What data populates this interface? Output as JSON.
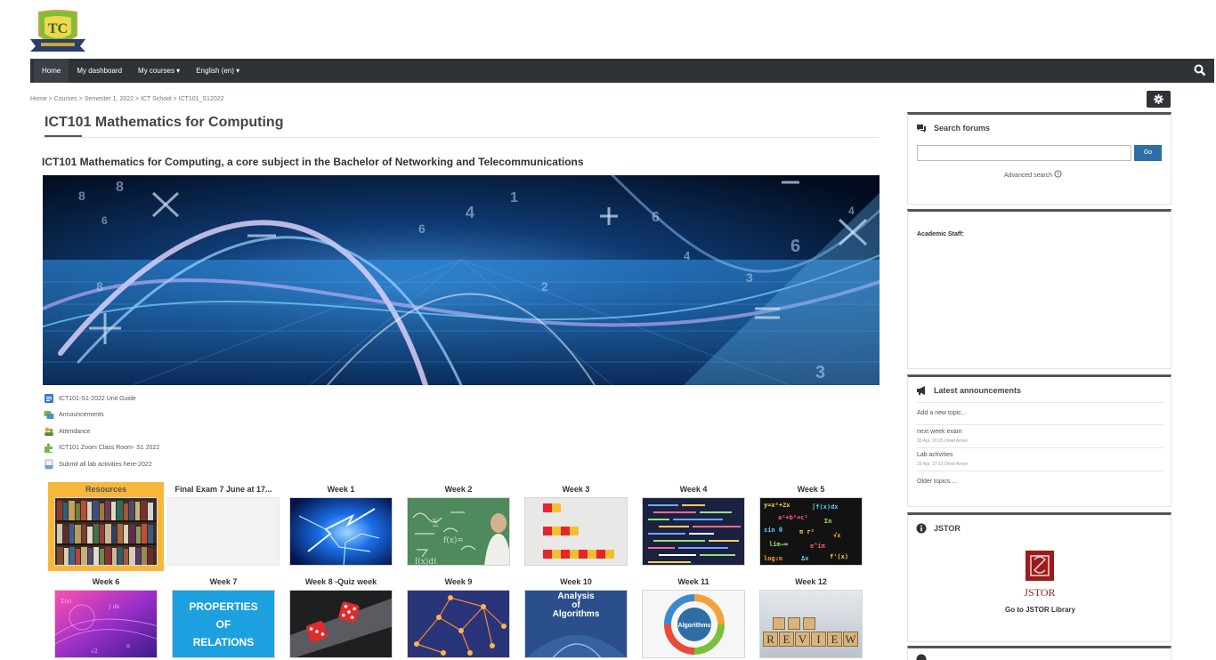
{
  "nav": {
    "items": [
      "Home",
      "My dashboard",
      "My courses ▾",
      "English (en) ▾"
    ]
  },
  "breadcrumb": [
    "Home",
    "Courses",
    "Semester 1, 2022",
    "ICT School",
    "ICT101_S12022"
  ],
  "breadcrumb_sep": ">",
  "page": {
    "title": "ICT101 Mathematics for Computing",
    "description": "ICT101 Mathematics for Computing, a core subject in the Bachelor of Networking and Telecommunications"
  },
  "resources": [
    {
      "label": "ICT101-S1-2022 Unit Guide",
      "icon": "document-icon"
    },
    {
      "label": "Announcements",
      "icon": "forum-icon"
    },
    {
      "label": "Attendance",
      "icon": "attendance-icon"
    },
    {
      "label": "ICT101 Zoom Class Room- S1 2022",
      "icon": "puzzle-icon"
    },
    {
      "label": "Submit all lab activities here-2022",
      "icon": "assignment-icon"
    }
  ],
  "tiles": [
    {
      "title": "Resources",
      "selected": true
    },
    {
      "title": "Final Exam 7 June at 17...",
      "selected": false
    },
    {
      "title": "Week 1",
      "selected": false
    },
    {
      "title": "Week 2",
      "selected": false
    },
    {
      "title": "Week 3",
      "selected": false
    },
    {
      "title": "Week 4",
      "selected": false
    },
    {
      "title": "Week 5",
      "selected": false
    },
    {
      "title": "Week 6",
      "selected": false
    },
    {
      "title": "Week 7",
      "selected": false
    },
    {
      "title": "Week 8 -Quiz week",
      "selected": false
    },
    {
      "title": "Week 9",
      "selected": false
    },
    {
      "title": "Week 10",
      "selected": false
    },
    {
      "title": "Week 11",
      "selected": false
    },
    {
      "title": "Week 12",
      "selected": false
    }
  ],
  "tile_image_text": {
    "week7": [
      "PROPERTIES",
      "OF",
      "RELATIONS"
    ],
    "week10": [
      "Analysis",
      "of",
      "Algorithms"
    ],
    "week11": "Algorithms",
    "week12": [
      "R",
      "E",
      "V",
      "I",
      "E",
      "W"
    ]
  },
  "search_forums": {
    "title": "Search forums",
    "go": "Go",
    "advanced": "Advanced search"
  },
  "academic": {
    "label": "Academic Staff:"
  },
  "announcements": {
    "title": "Latest announcements",
    "add": "Add a new topic...",
    "items": [
      {
        "title": "next week exam",
        "meta": "30 Apr, 20:25 Omid Ameri"
      },
      {
        "title": "Lab activities",
        "meta": "23 Apr, 17:12 Omid Ameri"
      }
    ],
    "older": "Older topics ..."
  },
  "jstor": {
    "title": "JSTOR",
    "logo_text": "JSTOR",
    "link": "Go to JSTOR Library"
  },
  "colors": {
    "navbar": "#2f3337",
    "accent": "#2f6ea5",
    "selected_tile": "#f6b73c"
  }
}
